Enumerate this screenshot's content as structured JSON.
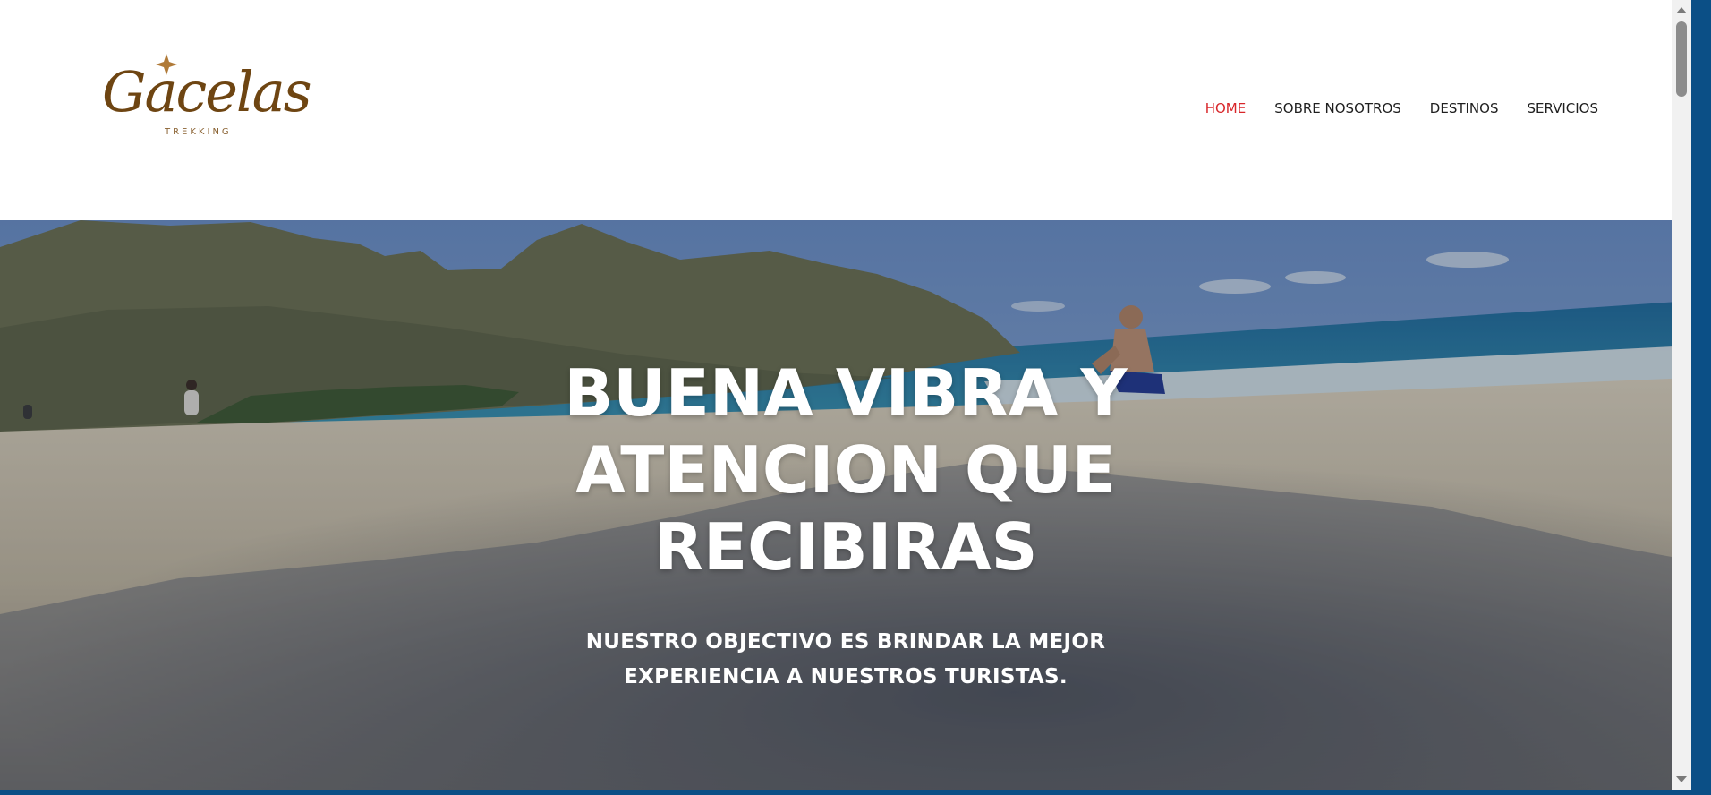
{
  "brand": {
    "name": "Gacelas",
    "tagline": "TREKKING",
    "color": "#6e4512"
  },
  "nav": {
    "items": [
      {
        "label": "HOME",
        "active": true
      },
      {
        "label": "SOBRE NOSOTROS",
        "active": false
      },
      {
        "label": "DESTINOS",
        "active": false
      },
      {
        "label": "SERVICIOS",
        "active": false
      }
    ],
    "active_color": "#d8262a"
  },
  "hero": {
    "title": "BUENA VIBRA Y ATENCION QUE RECIBIRAS",
    "subtitle": "NUESTRO OBJECTIVO ES BRINDAR LA MEJOR EXPERIENCIA A NUESTROS TURISTAS."
  }
}
